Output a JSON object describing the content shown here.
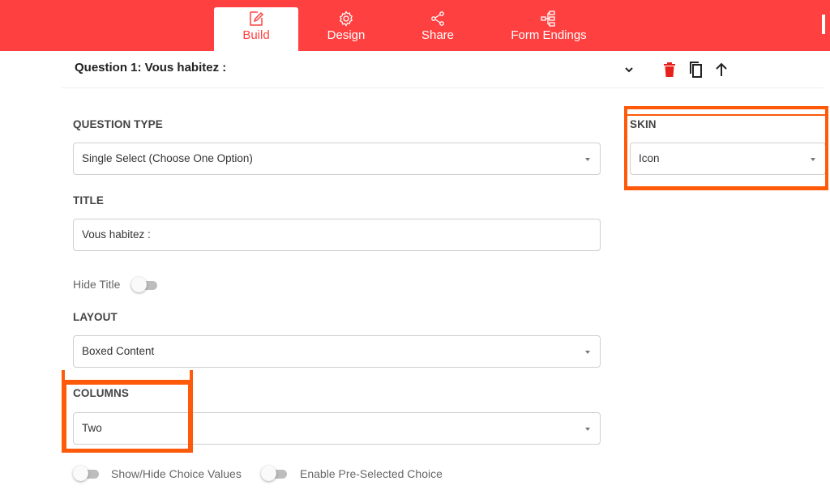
{
  "colors": {
    "brand": "#ff4040",
    "highlight": "#ff5a0a"
  },
  "nav": {
    "tabs": [
      {
        "label": "Build",
        "icon": "pencil-edit-icon",
        "active": true
      },
      {
        "label": "Design",
        "icon": "gear-icon",
        "active": false
      },
      {
        "label": "Share",
        "icon": "share-icon",
        "active": false
      },
      {
        "label": "Form Endings",
        "icon": "flowchart-icon",
        "active": false
      }
    ]
  },
  "question": {
    "title": "Question 1: Vous habitez :",
    "actions": [
      "chevron-down-icon",
      "trash-icon",
      "copy-icon",
      "arrow-up-icon"
    ]
  },
  "form": {
    "question_type": {
      "label": "QUESTION TYPE",
      "value": "Single Select (Choose One Option)"
    },
    "skin": {
      "label": "SKIN",
      "value": "Icon"
    },
    "title": {
      "label": "TITLE",
      "value": "Vous habitez :"
    },
    "hide_title": {
      "label": "Hide Title",
      "on": false
    },
    "layout": {
      "label": "LAYOUT",
      "value": "Boxed Content"
    },
    "columns": {
      "label": "COLUMNS",
      "value": "Two"
    },
    "show_hide_choice_values": {
      "label": "Show/Hide Choice Values",
      "on": false
    },
    "enable_preselected": {
      "label": "Enable Pre-Selected Choice",
      "on": false
    }
  }
}
